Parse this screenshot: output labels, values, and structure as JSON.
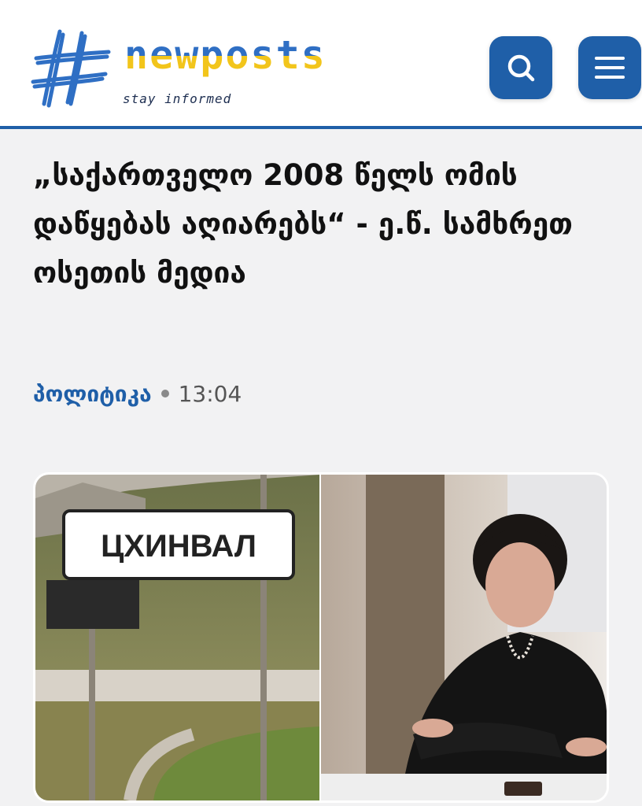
{
  "header": {
    "logo_text": "newposts",
    "tagline": "stay informed",
    "brand_color": "#1f5fa8",
    "accent_yellow": "#f2c51b"
  },
  "article": {
    "title": "„საქართველო 2008 წელს ომის დაწყებას აღიარებს“ - ე.წ. სამხრეთ ოსეთის მედია",
    "category": "პოლიტიკა",
    "time": "13:04",
    "image": {
      "sign_text": "ЦХИНВАЛ"
    }
  },
  "icons": {
    "search": "search-icon",
    "menu": "hamburger-menu-icon"
  }
}
